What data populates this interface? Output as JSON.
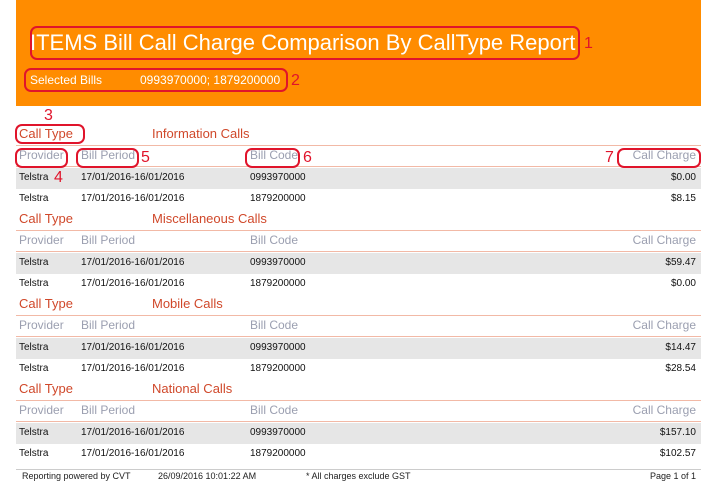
{
  "report": {
    "title": "ITEMS Bill Call Charge Comparison By CallType Report",
    "selected_bills_label": "Selected Bills",
    "selected_bills_value": "0993970000; 1879200000"
  },
  "labels": {
    "call_type": "Call Type",
    "provider": "Provider",
    "bill_period": "Bill Period",
    "bill_code": "Bill Code",
    "call_charge": "Call Charge"
  },
  "annotations": [
    "1",
    "2",
    "3",
    "4",
    "5",
    "6",
    "7"
  ],
  "sections": [
    {
      "call_type": "Information Calls",
      "rows": [
        {
          "provider": "Telstra",
          "bill_period": "17/01/2016-16/01/2016",
          "bill_code": "0993970000",
          "call_charge": "$0.00"
        },
        {
          "provider": "Telstra",
          "bill_period": "17/01/2016-16/01/2016",
          "bill_code": "1879200000",
          "call_charge": "$8.15"
        }
      ]
    },
    {
      "call_type": "Miscellaneous Calls",
      "rows": [
        {
          "provider": "Telstra",
          "bill_period": "17/01/2016-16/01/2016",
          "bill_code": "0993970000",
          "call_charge": "$59.47"
        },
        {
          "provider": "Telstra",
          "bill_period": "17/01/2016-16/01/2016",
          "bill_code": "1879200000",
          "call_charge": "$0.00"
        }
      ]
    },
    {
      "call_type": "Mobile Calls",
      "rows": [
        {
          "provider": "Telstra",
          "bill_period": "17/01/2016-16/01/2016",
          "bill_code": "0993970000",
          "call_charge": "$14.47"
        },
        {
          "provider": "Telstra",
          "bill_period": "17/01/2016-16/01/2016",
          "bill_code": "1879200000",
          "call_charge": "$28.54"
        }
      ]
    },
    {
      "call_type": "National Calls",
      "rows": [
        {
          "provider": "Telstra",
          "bill_period": "17/01/2016-16/01/2016",
          "bill_code": "0993970000",
          "call_charge": "$157.10"
        },
        {
          "provider": "Telstra",
          "bill_period": "17/01/2016-16/01/2016",
          "bill_code": "1879200000",
          "call_charge": "$102.57"
        }
      ]
    }
  ],
  "footer": {
    "powered_by": "Reporting powered by CVT",
    "timestamp": "26/09/2016 10:01:22 AM",
    "note": "* All charges exclude GST",
    "page": "Page 1 of 1"
  },
  "colors": {
    "header_bg": "#ff8c00",
    "call_type_text": "#d0482a",
    "column_header_text": "#9b9fb0",
    "annotation_red": "#e0142b",
    "row_alt_bg": "#e6e6e6"
  }
}
